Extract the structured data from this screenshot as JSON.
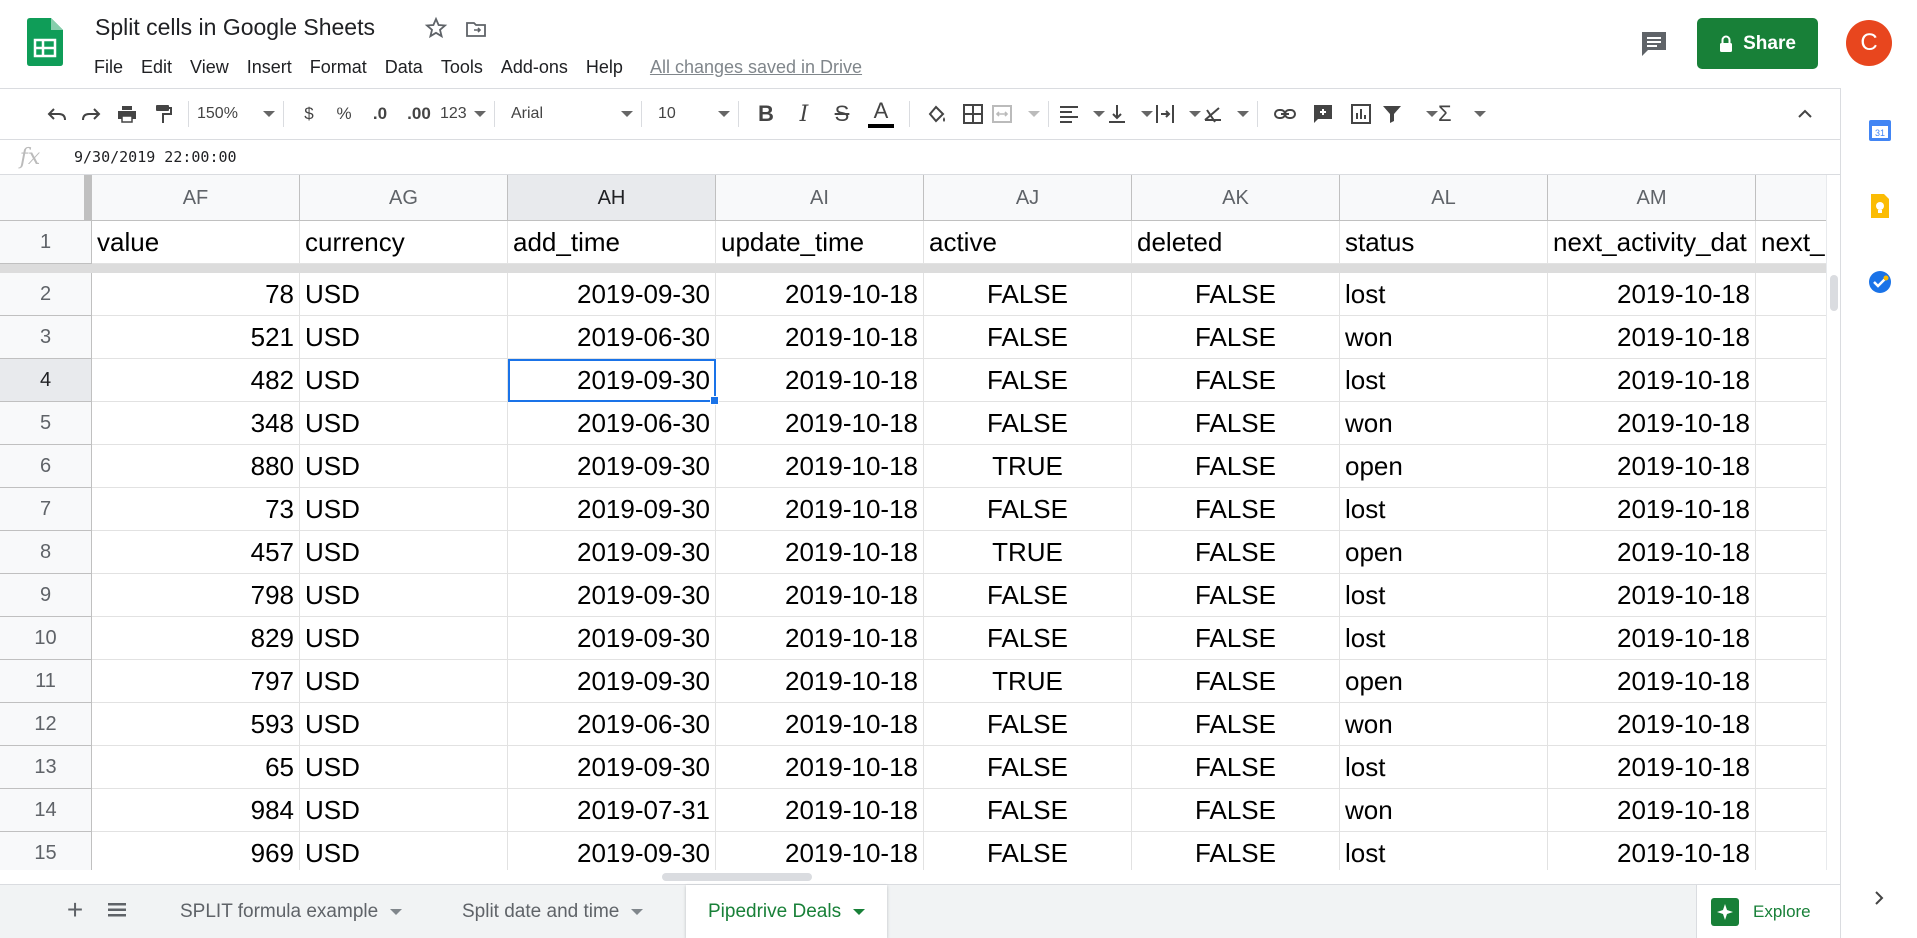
{
  "header": {
    "title": "Split cells in Google Sheets",
    "menu": [
      "File",
      "Edit",
      "View",
      "Insert",
      "Format",
      "Data",
      "Tools",
      "Add-ons",
      "Help"
    ],
    "saved_status": "All changes saved in Drive",
    "share_label": "Share",
    "avatar_initial": "C"
  },
  "toolbar": {
    "zoom": "150%",
    "currency": "$",
    "percent": "%",
    "decrease_decimal": ".0",
    "increase_decimal": ".00",
    "more_formats": "123",
    "font": "Arial",
    "font_size": "10",
    "bold": "B",
    "italic": "I",
    "strikethrough": "S",
    "text_color_glyph": "A",
    "sum_glyph": "Σ"
  },
  "formula_bar": {
    "fx": "fx",
    "value": "9/30/2019 22:00:00"
  },
  "grid": {
    "columns": [
      "AF",
      "AG",
      "AH",
      "AI",
      "AJ",
      "AK",
      "AL",
      "AM",
      ""
    ],
    "header_row": {
      "number": "1",
      "cells": [
        "value",
        "currency",
        "add_time",
        "update_time",
        "active",
        "deleted",
        "status",
        "next_activity_dat",
        "next_"
      ]
    },
    "rows": [
      {
        "n": "2",
        "cells": [
          "78",
          "USD",
          "2019-09-30",
          "2019-10-18",
          "FALSE",
          "FALSE",
          "lost",
          "2019-10-18"
        ]
      },
      {
        "n": "3",
        "cells": [
          "521",
          "USD",
          "2019-06-30",
          "2019-10-18",
          "FALSE",
          "FALSE",
          "won",
          "2019-10-18"
        ]
      },
      {
        "n": "4",
        "cells": [
          "482",
          "USD",
          "2019-09-30",
          "2019-10-18",
          "FALSE",
          "FALSE",
          "lost",
          "2019-10-18"
        ]
      },
      {
        "n": "5",
        "cells": [
          "348",
          "USD",
          "2019-06-30",
          "2019-10-18",
          "FALSE",
          "FALSE",
          "won",
          "2019-10-18"
        ]
      },
      {
        "n": "6",
        "cells": [
          "880",
          "USD",
          "2019-09-30",
          "2019-10-18",
          "TRUE",
          "FALSE",
          "open",
          "2019-10-18"
        ]
      },
      {
        "n": "7",
        "cells": [
          "73",
          "USD",
          "2019-09-30",
          "2019-10-18",
          "FALSE",
          "FALSE",
          "lost",
          "2019-10-18"
        ]
      },
      {
        "n": "8",
        "cells": [
          "457",
          "USD",
          "2019-09-30",
          "2019-10-18",
          "TRUE",
          "FALSE",
          "open",
          "2019-10-18"
        ]
      },
      {
        "n": "9",
        "cells": [
          "798",
          "USD",
          "2019-09-30",
          "2019-10-18",
          "FALSE",
          "FALSE",
          "lost",
          "2019-10-18"
        ]
      },
      {
        "n": "10",
        "cells": [
          "829",
          "USD",
          "2019-09-30",
          "2019-10-18",
          "FALSE",
          "FALSE",
          "lost",
          "2019-10-18"
        ]
      },
      {
        "n": "11",
        "cells": [
          "797",
          "USD",
          "2019-09-30",
          "2019-10-18",
          "TRUE",
          "FALSE",
          "open",
          "2019-10-18"
        ]
      },
      {
        "n": "12",
        "cells": [
          "593",
          "USD",
          "2019-06-30",
          "2019-10-18",
          "FALSE",
          "FALSE",
          "won",
          "2019-10-18"
        ]
      },
      {
        "n": "13",
        "cells": [
          "65",
          "USD",
          "2019-09-30",
          "2019-10-18",
          "FALSE",
          "FALSE",
          "lost",
          "2019-10-18"
        ]
      },
      {
        "n": "14",
        "cells": [
          "984",
          "USD",
          "2019-07-31",
          "2019-10-18",
          "FALSE",
          "FALSE",
          "won",
          "2019-10-18"
        ]
      },
      {
        "n": "15",
        "cells": [
          "969",
          "USD",
          "2019-09-30",
          "2019-10-18",
          "FALSE",
          "FALSE",
          "lost",
          "2019-10-18"
        ]
      }
    ],
    "selected_cell": "AH4"
  },
  "sheet_tabs": [
    {
      "label": "SPLIT formula example",
      "active": false
    },
    {
      "label": "Split date and time",
      "active": false
    },
    {
      "label": "Pipedrive Deals",
      "active": true
    }
  ],
  "explore_label": "Explore",
  "colors": {
    "brand_green": "#188038",
    "selection_blue": "#1a73e8",
    "avatar": "#e8461e"
  },
  "icons": [
    "undo-icon",
    "redo-icon",
    "print-icon",
    "paint-format-icon",
    "fill-color-icon",
    "borders-icon",
    "merge-cells-icon",
    "align-icon",
    "valign-icon",
    "wrap-icon",
    "rotate-icon",
    "link-icon",
    "comment-icon",
    "chart-icon",
    "filter-icon",
    "functions-icon",
    "calendar-icon",
    "keep-icon",
    "tasks-icon"
  ]
}
